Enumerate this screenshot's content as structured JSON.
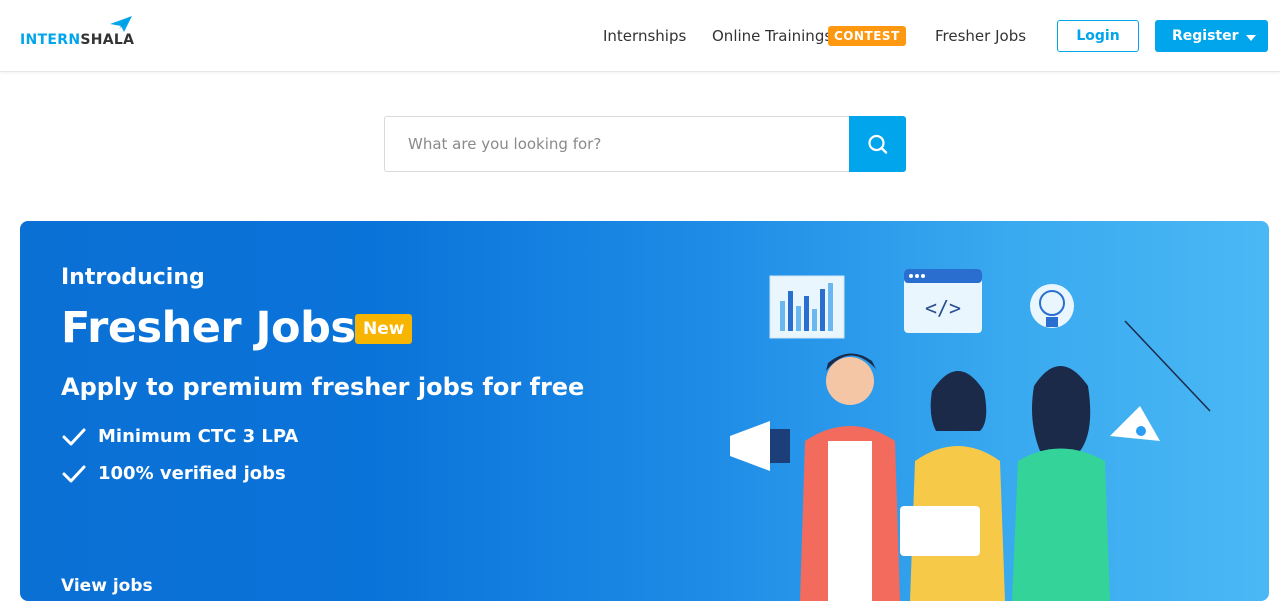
{
  "header": {
    "logo": {
      "text_part1": "INTERN",
      "text_part2": "SHALA",
      "icon": "paper-plane-icon"
    },
    "nav": [
      {
        "label": "Internships"
      },
      {
        "label": "Online Trainings",
        "badge": "CONTEST"
      },
      {
        "label": "Fresher Jobs"
      }
    ],
    "login_label": "Login",
    "register_label": "Register"
  },
  "search": {
    "placeholder": "What are you looking for?",
    "value": "",
    "icon": "search-icon"
  },
  "banner": {
    "intro": "Introducing",
    "title": "Fresher Jobs",
    "badge": "New",
    "subtitle": "Apply to premium fresher jobs for free",
    "features": [
      {
        "text": "Minimum CTC 3 LPA",
        "icon": "check-icon"
      },
      {
        "text": "100% verified jobs",
        "icon": "check-icon"
      }
    ],
    "cta": "View jobs",
    "illustration": "people-illustration"
  },
  "colors": {
    "brand": "#00a5ec",
    "contest_badge": "#ff9811",
    "new_badge": "#f7b500",
    "banner_start": "#0b70d4",
    "banner_end": "#4ab8f4"
  }
}
